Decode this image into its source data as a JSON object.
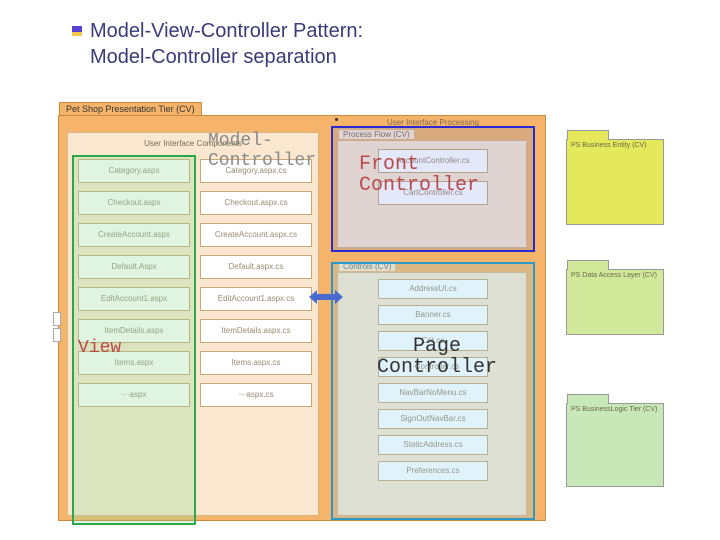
{
  "title": {
    "line1": "Model-View-Controller Pattern:",
    "line2": "Model-Controller separation"
  },
  "tier": {
    "label": "Pet Shop Presentation Tier (CV)"
  },
  "ui_components": {
    "label": "User Interface Components",
    "left": [
      "Category.aspx",
      "Checkout.aspx",
      "CreateAccount.aspx",
      "Default.Aspx",
      "EditAccount1.aspx",
      "ItemDetails.aspx",
      "Items.aspx",
      "···aspx"
    ],
    "right": [
      "Category.aspx.cs",
      "Checkout.aspx.cs",
      "CreateAccount.aspx.cs",
      "Default.aspx.cs",
      "EditAccount1.aspx.cs",
      "ItemDetails.aspx.cs",
      "Items.aspx.cs",
      "···aspx.cs"
    ]
  },
  "overlays": {
    "view": "View",
    "model_controller": "Model-Controller",
    "front": "Front\nController",
    "page": "Page\nController"
  },
  "ui_processing": {
    "label": "User Interface Processing"
  },
  "process_flow": {
    "label": "Process Flow (CV)",
    "items": [
      "AccountController.cs",
      "CartController.cs"
    ]
  },
  "controls": {
    "label": "Controls (CV)",
    "items": [
      "AddressUI.cs",
      "Banner.cs",
      "Crit.cs",
      "···Controller.cs",
      "NavBarNoMenu.cs",
      "SignOutNavBar.cs",
      "StaticAddress.cs",
      "Preferences.cs"
    ]
  },
  "packages": {
    "entity": "PS Business Entity (CV)",
    "dal": "PS Data Access Layer (CV)",
    "logic": "PS BusinessLogic Tier (CV)"
  }
}
